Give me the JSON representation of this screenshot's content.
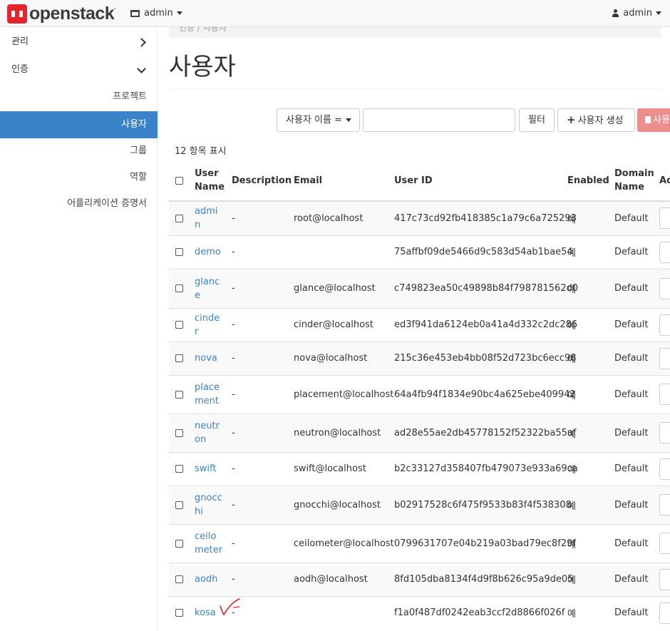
{
  "header": {
    "logo_text": "openstack",
    "logo_suffix": ".",
    "project_label": "admin",
    "user_label": "admin"
  },
  "sidebar": {
    "groups": [
      {
        "label": "관리",
        "expanded": false
      },
      {
        "label": "인증",
        "expanded": true
      }
    ],
    "items": [
      {
        "label": "프로젝트"
      },
      {
        "label": "사용자",
        "active": true
      },
      {
        "label": "그룹"
      },
      {
        "label": "역할"
      },
      {
        "label": "어플리케이션 증명서"
      }
    ]
  },
  "breadcrumb": "인증 / 사용자",
  "page": {
    "title": "사용자"
  },
  "toolbar": {
    "filter_select": "사용자 이름 =",
    "filter_input_value": "",
    "filter_button": "필터",
    "create_button": "사용자 생성",
    "delete_button": "사용"
  },
  "table": {
    "count_label": "12 항목 표시",
    "columns": [
      "User Name",
      "Description",
      "Email",
      "User ID",
      "Enabled",
      "Domain Name",
      "Ac"
    ],
    "rows": [
      {
        "name": "admin",
        "description": "-",
        "email": "root@localhost",
        "id": "417c73cd92fb418385c1a79c6a725293",
        "enabled": "예",
        "domain": "Default"
      },
      {
        "name": "demo",
        "description": "-",
        "email": "",
        "id": "75affbf09de5466d9c583d54ab1bae54",
        "enabled": "예",
        "domain": "Default"
      },
      {
        "name": "glance",
        "description": "-",
        "email": "glance@localhost",
        "id": "c749823ea50c49898b84f798781562d0",
        "enabled": "예",
        "domain": "Default"
      },
      {
        "name": "cinder",
        "description": "-",
        "email": "cinder@localhost",
        "id": "ed3f941da6124eb0a41a4d332c2dc286",
        "enabled": "예",
        "domain": "Default"
      },
      {
        "name": "nova",
        "description": "-",
        "email": "nova@localhost",
        "id": "215c36e453eb4bb08f52d723bc6ecc98",
        "enabled": "예",
        "domain": "Default"
      },
      {
        "name": "placement",
        "description": "-",
        "email": "placement@localhost",
        "id": "64a4fb94f1834e90bc4a625ebe409942",
        "enabled": "예",
        "domain": "Default"
      },
      {
        "name": "neutron",
        "description": "-",
        "email": "neutron@localhost",
        "id": "ad28e55ae2db45778152f52322ba55af",
        "enabled": "예",
        "domain": "Default"
      },
      {
        "name": "swift",
        "description": "-",
        "email": "swift@localhost",
        "id": "b2c33127d358407fb479073e933a69ca",
        "enabled": "예",
        "domain": "Default"
      },
      {
        "name": "gnocchi",
        "description": "-",
        "email": "gnocchi@localhost",
        "id": "b02917528c6f475f9533b83f4f538308",
        "enabled": "예",
        "domain": "Default"
      },
      {
        "name": "ceilometer",
        "description": "-",
        "email": "ceilometer@localhost",
        "id": "0799631707e04b219a03bad79ec8f29f",
        "enabled": "예",
        "domain": "Default"
      },
      {
        "name": "aodh",
        "description": "-",
        "email": "aodh@localhost",
        "id": "8fd105dba8134f4d9f8b626c95a9de05",
        "enabled": "예",
        "domain": "Default"
      },
      {
        "name": "kosa",
        "description": "-",
        "email": "",
        "id": "f1a0f487df0242eab3ccf2d8866f026f",
        "enabled": "예",
        "domain": "Default"
      }
    ]
  },
  "colors": {
    "brand_red": "#e3262b",
    "active_blue": "#3b83c9",
    "link_blue": "#3b83c9",
    "delete_red": "#ec8e8e",
    "annotation_red": "#e0202a"
  }
}
